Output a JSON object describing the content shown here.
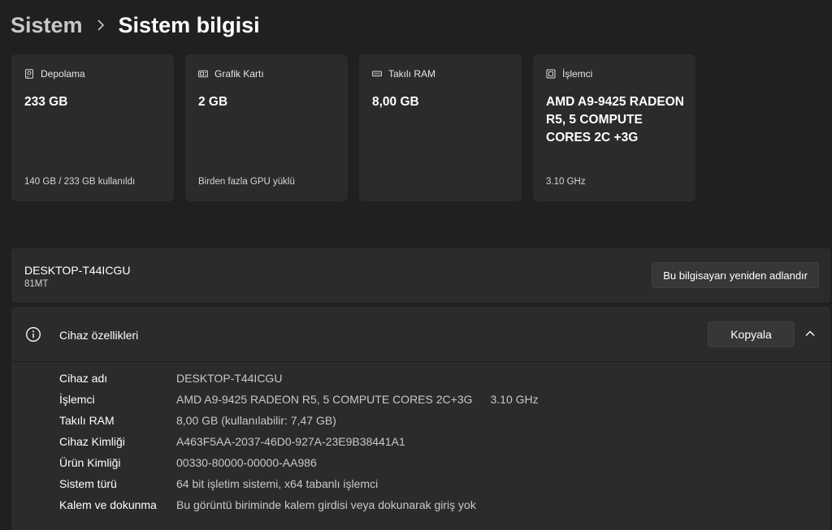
{
  "breadcrumb": {
    "parent": "Sistem",
    "current": "Sistem bilgisi"
  },
  "cards": [
    {
      "icon": "storage-icon",
      "label": "Depolama",
      "value": "233 GB",
      "footer": "140 GB / 233 GB kullanıldı"
    },
    {
      "icon": "graphics-card-icon",
      "label": "Grafik Kartı",
      "value": "2 GB",
      "footer": "Birden fazla GPU yüklü"
    },
    {
      "icon": "ram-icon",
      "label": "Takılı RAM",
      "value": "8,00 GB",
      "footer": ""
    },
    {
      "icon": "processor-icon",
      "label": "İşlemci",
      "value": "AMD A9-9425 RADEON R5, 5 COMPUTE CORES 2C +3G",
      "footer": "3.10 GHz"
    }
  ],
  "device": {
    "name": "DESKTOP-T44ICGU",
    "model": "81MT",
    "rename_label": "Bu bilgisayarı yeniden adlandır"
  },
  "specs": {
    "title": "Cihaz özellikleri",
    "copy_label": "Kopyala",
    "rows": [
      {
        "label": "Cihaz adı",
        "value": "DESKTOP-T44ICGU",
        "extra": ""
      },
      {
        "label": "İşlemci",
        "value": "AMD A9-9425 RADEON R5, 5 COMPUTE CORES 2C+3G",
        "extra": "3.10 GHz"
      },
      {
        "label": "Takılı RAM",
        "value": "8,00 GB (kullanılabilir: 7,47 GB)",
        "extra": ""
      },
      {
        "label": "Cihaz Kimliği",
        "value": "A463F5AA-2037-46D0-927A-23E9B38441A1",
        "extra": ""
      },
      {
        "label": "Ürün Kimliği",
        "value": "00330-80000-00000-AA986",
        "extra": ""
      },
      {
        "label": "Sistem türü",
        "value": "64 bit işletim sistemi, x64 tabanlı işlemci",
        "extra": ""
      },
      {
        "label": "Kalem ve dokunma",
        "value": "Bu görüntü biriminde kalem girdisi veya dokunarak giriş yok",
        "extra": ""
      }
    ]
  }
}
